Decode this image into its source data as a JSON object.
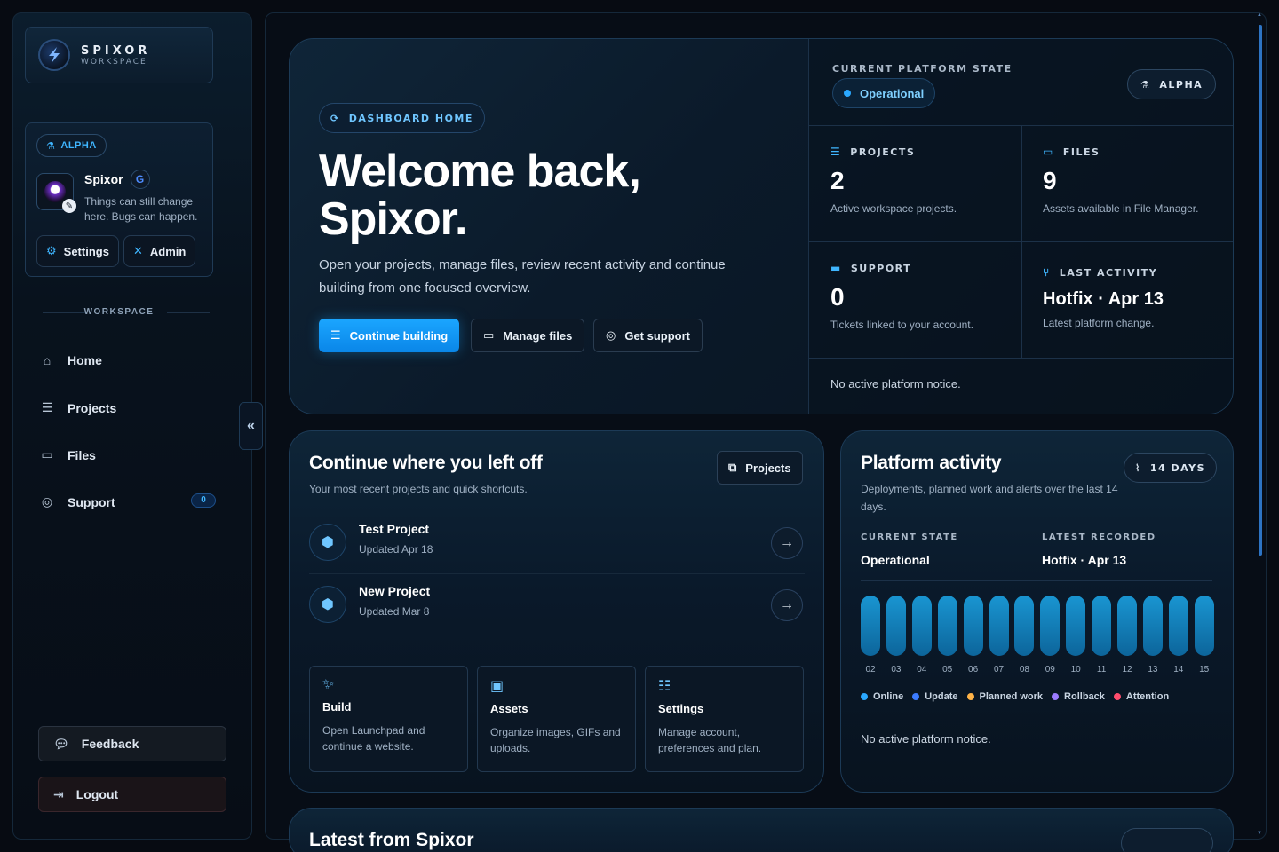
{
  "brand": {
    "name": "SPIXOR",
    "sub": "WORKSPACE",
    "logo_icon": "s-bolt-logo"
  },
  "profile": {
    "badge": "ALPHA",
    "name": "Spixor",
    "provider_icon": "G",
    "description": "Things can still change here. Bugs can happen.",
    "settings_label": "Settings",
    "admin_label": "Admin"
  },
  "sidebar": {
    "section_label": "WORKSPACE",
    "items": [
      {
        "label": "Home",
        "icon": "home-icon"
      },
      {
        "label": "Projects",
        "icon": "layers-icon"
      },
      {
        "label": "Files",
        "icon": "folder-icon"
      },
      {
        "label": "Support",
        "icon": "lifebuoy-icon",
        "count": "0"
      }
    ],
    "feedback_label": "Feedback",
    "logout_label": "Logout",
    "collapse_icon": "«"
  },
  "hero": {
    "pill": "DASHBOARD HOME",
    "title": "Welcome back, Spixor.",
    "description": "Open your projects, manage files, review recent activity and continue building from one focused overview.",
    "buttons": {
      "continue": "Continue building",
      "files": "Manage files",
      "support": "Get support"
    }
  },
  "platform_state": {
    "label": "CURRENT PLATFORM STATE",
    "status": "Operational",
    "badge": "ALPHA",
    "stats": [
      {
        "label": "PROJECTS",
        "value": "2",
        "desc": "Active workspace projects."
      },
      {
        "label": "FILES",
        "value": "9",
        "desc": "Assets available in File Manager."
      },
      {
        "label": "SUPPORT",
        "value": "0",
        "desc": "Tickets linked to your account."
      },
      {
        "label": "LAST ACTIVITY",
        "value": "Hotfix · Apr 13",
        "desc": "Latest platform change."
      }
    ],
    "notice": "No active platform notice."
  },
  "continue_card": {
    "title": "Continue where you left off",
    "subtitle": "Your most recent projects and quick shortcuts.",
    "projects_button": "Projects",
    "projects": [
      {
        "name": "Test Project",
        "updated": "Updated Apr 18"
      },
      {
        "name": "New Project",
        "updated": "Updated Mar 8"
      }
    ],
    "tiles": [
      {
        "title": "Build",
        "desc": "Open Launchpad and continue a website.",
        "icon": "magic-wand-icon"
      },
      {
        "title": "Assets",
        "desc": "Organize images, GIFs and uploads.",
        "icon": "image-icon"
      },
      {
        "title": "Settings",
        "desc": "Manage account, preferences and plan.",
        "icon": "sliders-icon"
      }
    ]
  },
  "activity_card": {
    "title": "Platform activity",
    "subtitle": "Deployments, planned work and alerts over the last 14 days.",
    "days_button": "14 DAYS",
    "current_state_label": "CURRENT STATE",
    "current_state_value": "Operational",
    "latest_label": "LATEST RECORDED",
    "latest_value": "Hotfix · Apr 13",
    "notice": "No active platform notice."
  },
  "chart_data": {
    "type": "bar",
    "categories": [
      "02",
      "03",
      "04",
      "05",
      "06",
      "07",
      "08",
      "09",
      "10",
      "11",
      "12",
      "13",
      "14",
      "15"
    ],
    "series": [
      {
        "name": "Online",
        "values": [
          1,
          1,
          1,
          1,
          1,
          1,
          1,
          1,
          1,
          1,
          1,
          1,
          1,
          1
        ]
      }
    ],
    "legend": [
      {
        "name": "Online",
        "color": "#2aa8ff"
      },
      {
        "name": "Update",
        "color": "#3b7bff"
      },
      {
        "name": "Planned work",
        "color": "#ffb347"
      },
      {
        "name": "Rollback",
        "color": "#9b7bff"
      },
      {
        "name": "Attention",
        "color": "#ff4d6d"
      }
    ],
    "title": "",
    "xlabel": "",
    "ylabel": ""
  },
  "latest_card": {
    "title": "Latest from Spixor"
  }
}
